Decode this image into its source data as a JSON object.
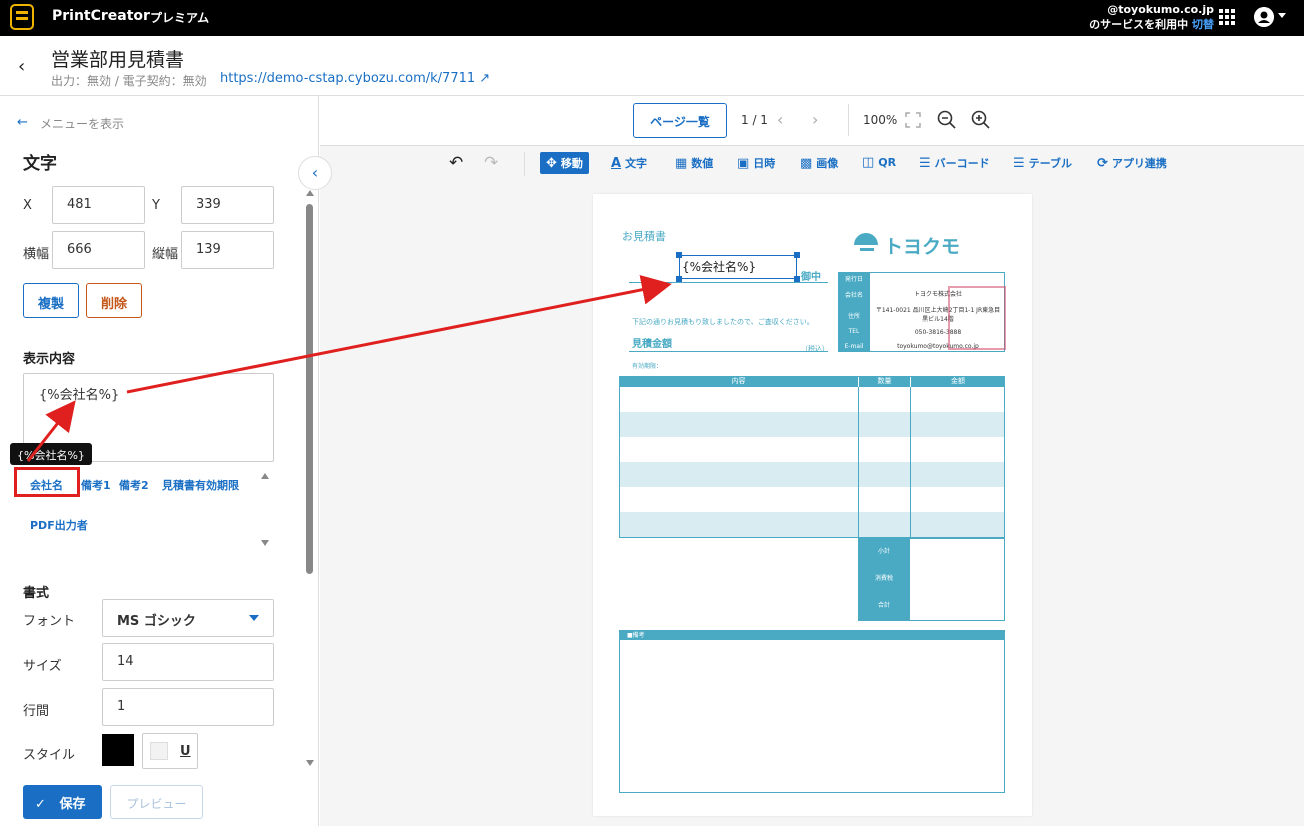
{
  "topbar": {
    "app_name": "PrintCreator",
    "plan": "プレミアム",
    "account_domain": "@toyokumo.co.jp",
    "account_line": "のサービスを利用中",
    "switch_label": "切替"
  },
  "header": {
    "title": "営業部用見積書",
    "meta": "出力：無効 / 電子契約：無効",
    "url": "https://demo-cstap.cybozu.com/k/7711"
  },
  "left": {
    "menu_toggle": "メニューを表示",
    "section_title": "文字",
    "x_label": "X",
    "x_value": "481",
    "y_label": "Y",
    "y_value": "339",
    "width_label": "横幅",
    "width_value": "666",
    "height_label": "縦幅",
    "height_value": "139",
    "duplicate_label": "複製",
    "delete_label": "削除",
    "content_label": "表示内容",
    "content_value": "{%会社名%}",
    "tooltip": "{%会社名%}",
    "field_tags": [
      "会社名",
      "備考1",
      "備考2",
      "見積書有効期限",
      "PDF出力者"
    ],
    "format_label": "書式",
    "font_label": "フォント",
    "font_value": "MS ゴシック",
    "size_label": "サイズ",
    "size_value": "14",
    "line_label": "行間",
    "line_value": "1",
    "style_label": "スタイル",
    "underline_label": "U",
    "save_label": "保存",
    "preview_label": "プレビュー"
  },
  "toolbar": {
    "page_list": "ページ一覧",
    "page_indicator": "1 / 1",
    "zoom": "100%",
    "tools": [
      "移動",
      "文字",
      "数値",
      "日時",
      "画像",
      "QR",
      "バーコード",
      "テーブル",
      "アプリ連携"
    ]
  },
  "doc": {
    "title": "お見積書",
    "company_placeholder": "{%会社名%}",
    "honorific": "御中",
    "logo": "トヨクモ",
    "note": "下記の通りお見積もり致しましたので、ご査収ください。",
    "amount_label": "見積金額",
    "tax_label": "（税込）",
    "valid_label": "有効期限：",
    "info_labels": [
      "発行日",
      "会社名",
      "住所",
      "TEL",
      "E-mail"
    ],
    "info_values": [
      "",
      "トヨクモ株式会社",
      "〒141-0021 品川区上大崎2丁目1-1 JR東急目黒ビル14階",
      "050-3816-3888",
      "toyokumo@toyokumo.co.jp"
    ],
    "table_headers": [
      "内容",
      "数量",
      "金額"
    ],
    "totals": [
      "小計",
      "消費税",
      "合計"
    ],
    "remarks_label": "■備考"
  },
  "colors": {
    "accent": "#1a6fc4",
    "teal": "#4aaac4",
    "delete": "#c4571a",
    "annotation": "#e0201e"
  }
}
